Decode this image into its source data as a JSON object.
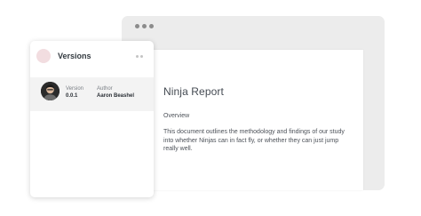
{
  "document": {
    "title": "Ninja Report",
    "section_heading": "Overview",
    "body": "This document outlines the methodology and findings of our study into whether Ninjas can in fact fly, or whether they can just jump really well."
  },
  "versions_panel": {
    "title": "Versions",
    "more_icon": "more-horizontal-icon",
    "entries": [
      {
        "version_label": "Version",
        "version_value": "0.0.1",
        "author_label": "Author",
        "author_value": "Aaron Beashel"
      }
    ]
  },
  "colors": {
    "browser_chrome": "#ececec",
    "panel_accent": "#f2dde0",
    "row_highlight": "#f3f3f3",
    "text_dark": "#333a40"
  }
}
